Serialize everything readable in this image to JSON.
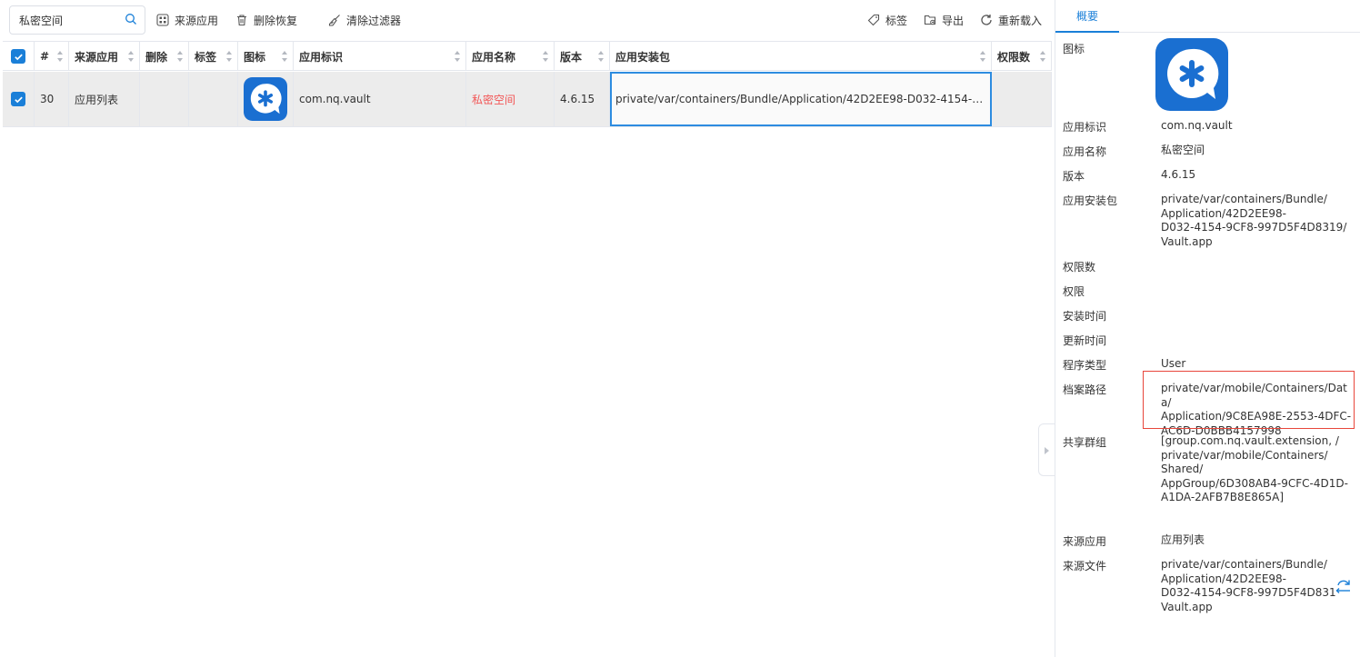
{
  "toolbar": {
    "search_value": "私密空间",
    "source_app_label": "来源应用",
    "delete_restore_label": "删除恢复",
    "clear_filter_label": "清除过滤器",
    "tag_label": "标签",
    "export_label": "导出",
    "reload_label": "重新载入"
  },
  "table": {
    "columns": [
      "#",
      "来源应用",
      "删除",
      "标签",
      "图标",
      "应用标识",
      "应用名称",
      "版本",
      "应用安装包",
      "权限数"
    ],
    "rows": [
      {
        "checked": true,
        "index": "30",
        "source_app": "应用列表",
        "deleted": "",
        "tag": "",
        "icon": "vault-app-icon",
        "bundle_id": "com.nq.vault",
        "app_name": "私密空间",
        "version": "4.6.15",
        "install_package": "private/var/containers/Bundle/Application/42D2EE98-D032-4154-9C...",
        "permission_count": ""
      }
    ]
  },
  "panel": {
    "tab_label": "概要",
    "fields": {
      "icon_label": "图标",
      "bundle_id_label": "应用标识",
      "bundle_id": "com.nq.vault",
      "app_name_label": "应用名称",
      "app_name": "私密空间",
      "version_label": "版本",
      "version": "4.6.15",
      "install_package_label": "应用安装包",
      "install_package": "private/var/containers/Bundle/\nApplication/42D2EE98-\nD032-4154-9CF8-997D5F4D8319/\nVault.app",
      "permission_count_label": "权限数",
      "permission_label": "权限",
      "install_time_label": "安装时间",
      "update_time_label": "更新时间",
      "program_type_label": "程序类型",
      "program_type": "User",
      "archive_path_label": "档案路径",
      "archive_path": "private/var/mobile/Containers/Data/\nApplication/9C8EA98E-2553-4DFC-\nAC6D-D0BBB4157998",
      "shared_group_label": "共享群组",
      "shared_group": "[group.com.nq.vault.extension, /\nprivate/var/mobile/Containers/\nShared/\nAppGroup/6D308AB4-9CFC-4D1D-\nA1DA-2AFB7B8E865A]",
      "source_app_label": "来源应用",
      "source_app": "应用列表",
      "source_file_label": "来源文件",
      "source_file": "private/var/containers/Bundle/\nApplication/42D2EE98-\nD032-4154-9CF8-997D5F4D831\nVault.app"
    }
  },
  "colors": {
    "accent": "#1a7fd8",
    "highlight": "#e8463b",
    "app_name_red": "#f25656",
    "icon_blue": "#1a6fd1"
  }
}
